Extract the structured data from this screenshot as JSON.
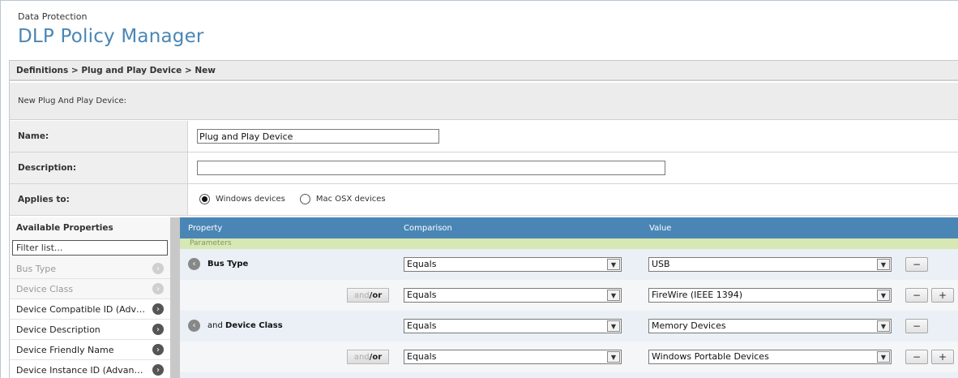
{
  "header": {
    "subtitle": "Data Protection",
    "title": "DLP Policy Manager"
  },
  "breadcrumb": "Definitions > Plug and Play Device > New",
  "section_title": "New Plug And Play Device:",
  "form": {
    "name_label": "Name:",
    "name_value": "Plug and Play Device",
    "description_label": "Description:",
    "description_value": "",
    "applies_label": "Applies to:",
    "applies_options": [
      "Windows devices",
      "Mac OSX devices"
    ],
    "applies_selected": "Windows devices"
  },
  "available": {
    "title": "Available Properties",
    "filter_placeholder": "Filter list...",
    "items": [
      {
        "label": "Bus Type",
        "disabled": true
      },
      {
        "label": "Device Class",
        "disabled": true
      },
      {
        "label": "Device Compatible ID (Advanced)",
        "disabled": false
      },
      {
        "label": "Device Description",
        "disabled": false
      },
      {
        "label": "Device Friendly Name",
        "disabled": false
      },
      {
        "label": "Device Instance ID (Advanced)",
        "disabled": false
      }
    ]
  },
  "criteria": {
    "headers": {
      "property": "Property",
      "comparison": "Comparison",
      "value": "Value"
    },
    "params_label": "Parameters",
    "andor_and": "and",
    "andor_or": "/or",
    "rows": [
      {
        "prefix": "",
        "property": "Bus Type",
        "comparison": "Equals",
        "value": "USB",
        "has_andor": false,
        "has_plus": false
      },
      {
        "prefix": "",
        "property": "",
        "comparison": "Equals",
        "value": "FireWire (IEEE 1394)",
        "has_andor": true,
        "has_plus": true
      },
      {
        "prefix": "and",
        "property": "Device Class",
        "comparison": "Equals",
        "value": "Memory Devices",
        "has_andor": false,
        "has_plus": false
      },
      {
        "prefix": "",
        "property": "",
        "comparison": "Equals",
        "value": "Windows Portable Devices",
        "has_andor": true,
        "has_plus": true
      }
    ]
  },
  "colors": {
    "title_blue": "#4a86b5",
    "header_blue": "#4a86b5",
    "params_green": "#d8e8b4"
  }
}
